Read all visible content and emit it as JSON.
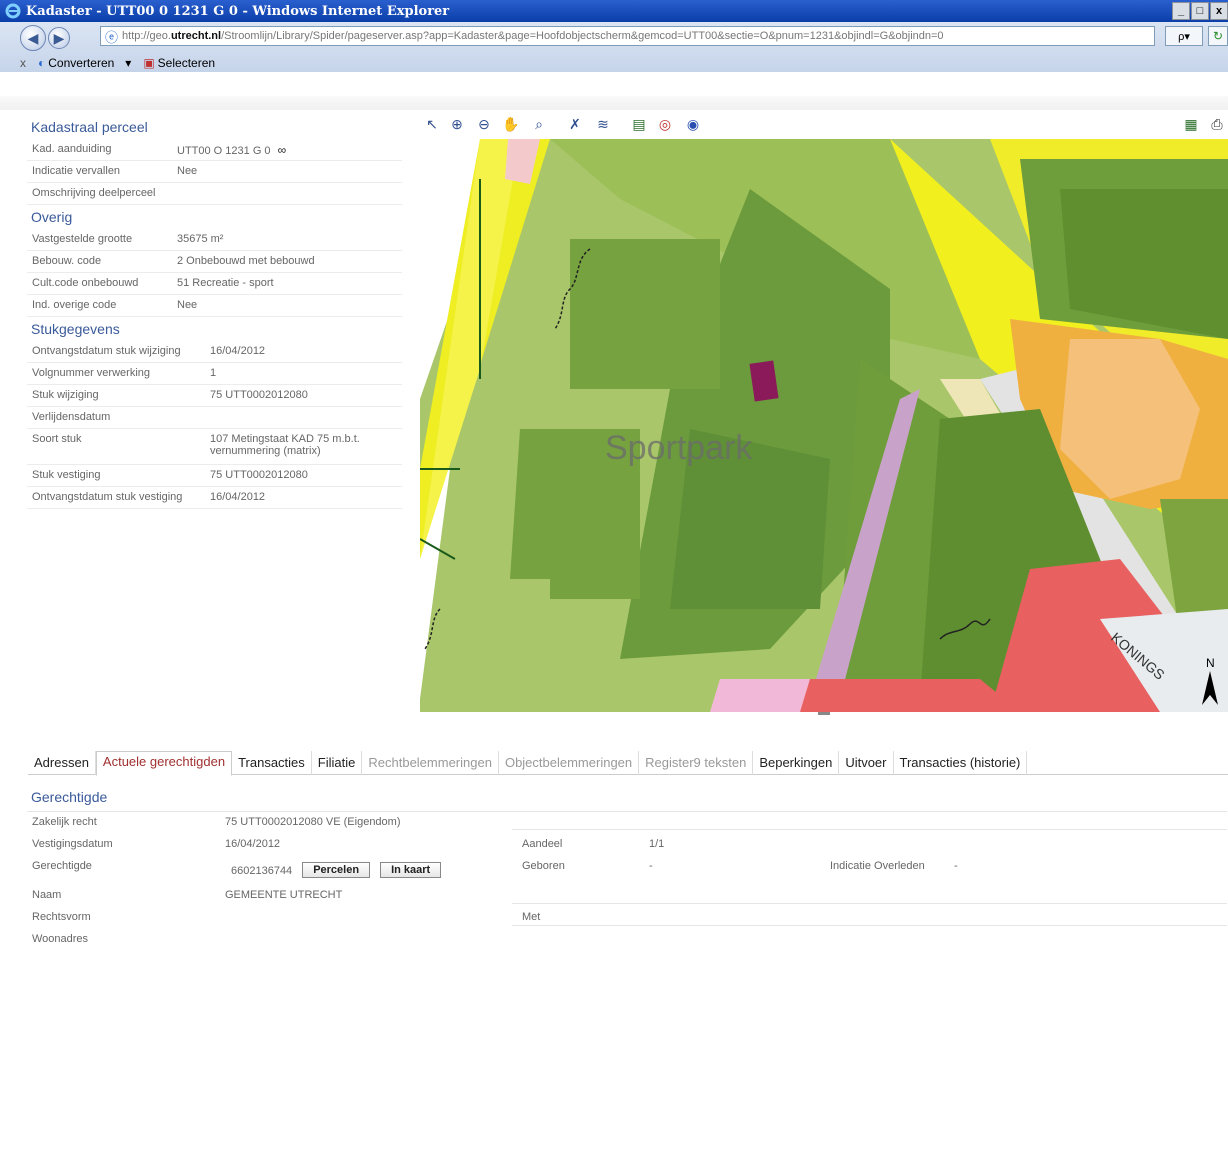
{
  "window": {
    "title": "Kadaster - UTT00 0 1231 G 0 - Windows Internet Explorer",
    "min": "_",
    "max": "□",
    "close": "x"
  },
  "address": {
    "prefix": "http://geo.",
    "host": "utrecht.nl",
    "rest": "/Stroomlijn/Library/Spider/pageserver.asp?app=Kadaster&page=Hoofdobjectscherm&gemcod=UTT00&sectie=O&pnum=1231&objindl=G&objindn=0",
    "search_symbol": "ρ▾",
    "refresh_symbol": "↻"
  },
  "toolbar": {
    "close_symbol": "x",
    "converteren": "Converteren",
    "dropdown_symbol": "▾",
    "selecteren": "Selecteren"
  },
  "kadastraal": {
    "title": "Kadastraal perceel",
    "rows": [
      {
        "label": "Kad. aanduiding",
        "value": "UTT00 O 1231 G 0"
      },
      {
        "label": "Indicatie vervallen",
        "value": "Nee"
      },
      {
        "label": "Omschrijving deelperceel",
        "value": ""
      }
    ]
  },
  "overig": {
    "title": "Overig",
    "rows": [
      {
        "label": "Vastgestelde grootte",
        "value": "35675 m²"
      },
      {
        "label": "Bebouw. code",
        "value": "2 Onbebouwd met bebouwd"
      },
      {
        "label": "Cult.code onbebouwd",
        "value": "51 Recreatie - sport"
      },
      {
        "label": "Ind. overige code",
        "value": "Nee"
      }
    ]
  },
  "stuk": {
    "title": "Stukgegevens",
    "rows": [
      {
        "label": "Ontvangstdatum stuk wijziging",
        "value": "16/04/2012"
      },
      {
        "label": "Volgnummer verwerking",
        "value": "1"
      },
      {
        "label": "Stuk wijziging",
        "value": "75 UTT0002012080"
      },
      {
        "label": "Verlijdensdatum",
        "value": ""
      },
      {
        "label": "Soort stuk",
        "value": "107 Metingstaat KAD 75 m.b.t. vernummering (matrix)"
      },
      {
        "label": "Stuk vestiging",
        "value": "75 UTT0002012080"
      },
      {
        "label": "Ontvangstdatum stuk vestiging",
        "value": "16/04/2012"
      }
    ]
  },
  "map": {
    "label": "Sportpark",
    "street": "KONINGS",
    "north": "N"
  },
  "tabs": [
    {
      "label": "Adressen"
    },
    {
      "label": "Actuele gerechtigden"
    },
    {
      "label": "Transacties"
    },
    {
      "label": "Filiatie"
    },
    {
      "label": "Rechtbelemmeringen"
    },
    {
      "label": "Objectbelemmeringen"
    },
    {
      "label": "Register9 teksten"
    },
    {
      "label": "Beperkingen"
    },
    {
      "label": "Uitvoer"
    },
    {
      "label": "Transacties (historie)"
    }
  ],
  "gerechtigde": {
    "title": "Gerechtigde",
    "zakelijk_label": "Zakelijk recht",
    "zakelijk_value": "75 UTT0002012080 VE (Eigendom)",
    "vestiging_label": "Vestigingsdatum",
    "vestiging_value": "16/04/2012",
    "aandeel_label": "Aandeel",
    "aandeel_value": "1/1",
    "gerechtigde_label": "Gerechtigde",
    "gerechtigde_value": "6602136744",
    "percelen_btn": "Percelen",
    "inkaart_btn": "In kaart",
    "geboren_label": "Geboren",
    "geboren_value": "-",
    "overleden_label": "Indicatie Overleden",
    "overleden_value": "-",
    "naam_label": "Naam",
    "naam_value": "GEMEENTE UTRECHT",
    "rechtsvorm_label": "Rechtsvorm",
    "met_label": "Met",
    "woonadres_label": "Woonadres"
  }
}
